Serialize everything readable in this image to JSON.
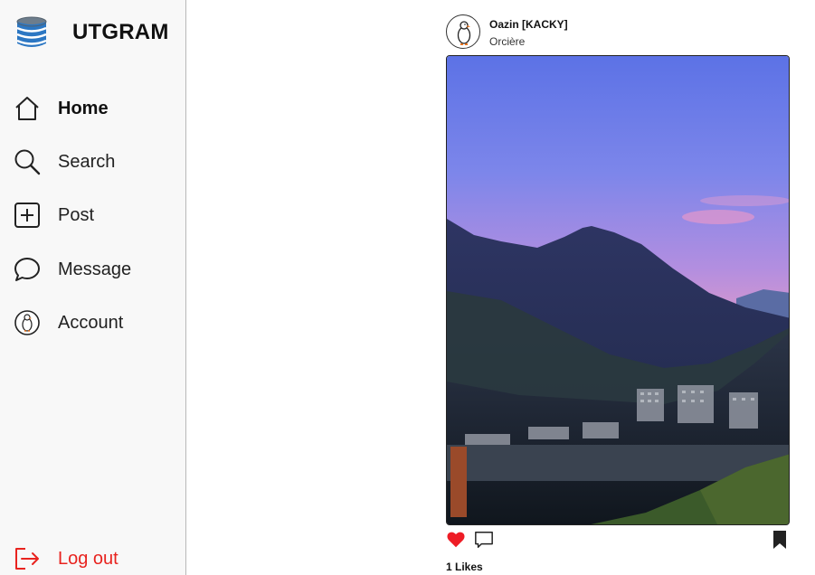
{
  "app": {
    "title": "UTGRAM"
  },
  "sidebar": {
    "items": [
      {
        "label": "Home",
        "icon": "home-icon"
      },
      {
        "label": "Search",
        "icon": "search-icon"
      },
      {
        "label": "Post",
        "icon": "plus-square-icon"
      },
      {
        "label": "Message",
        "icon": "chat-bubble-icon"
      },
      {
        "label": "Account",
        "icon": "avatar-icon"
      }
    ],
    "logout": {
      "label": "Log out",
      "icon": "logout-icon"
    }
  },
  "post": {
    "username": "Oazin [KACKY]",
    "location": "Orcière",
    "likes_text": "1 Likes",
    "liked": true
  },
  "colors": {
    "accent_red": "#e8231f",
    "like_red": "#ee1c25",
    "sidebar_bg": "#f8f8f8"
  }
}
